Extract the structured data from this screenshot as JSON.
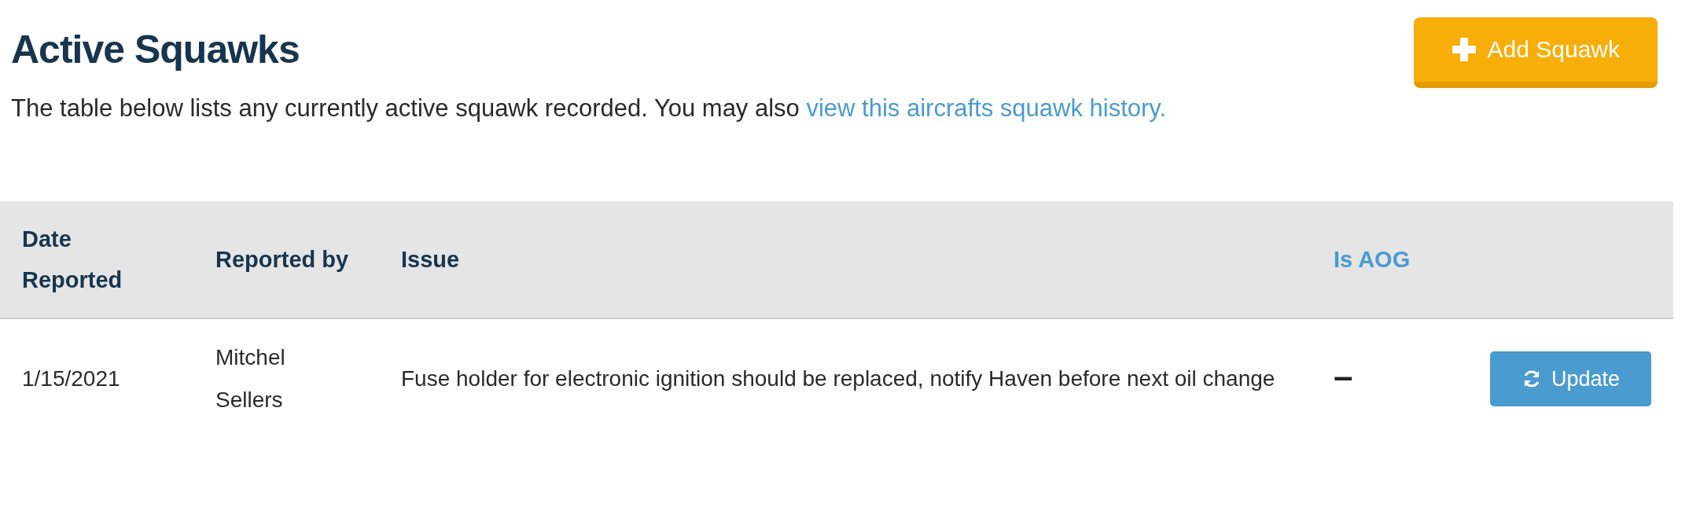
{
  "heading": "Active Squawks",
  "intro": {
    "text": "The table below lists any currently active squawk recorded. You may also",
    "link": "view this aircrafts squawk history."
  },
  "add_button": {
    "label": "Add Squawk"
  },
  "table": {
    "columns": [
      {
        "label": "Date Reported",
        "sortable": false
      },
      {
        "label": "Reported by",
        "sortable": false
      },
      {
        "label": "Issue",
        "sortable": false
      },
      {
        "label": "Is AOG",
        "sortable": true
      }
    ],
    "rows": [
      {
        "date": "1/15/2021",
        "reported_by": "Mitchel Sellers",
        "issue": "Fuse holder for electronic ignition should be replaced, notify Haven before next oil change",
        "is_aog": "–",
        "action": "Update"
      }
    ]
  }
}
